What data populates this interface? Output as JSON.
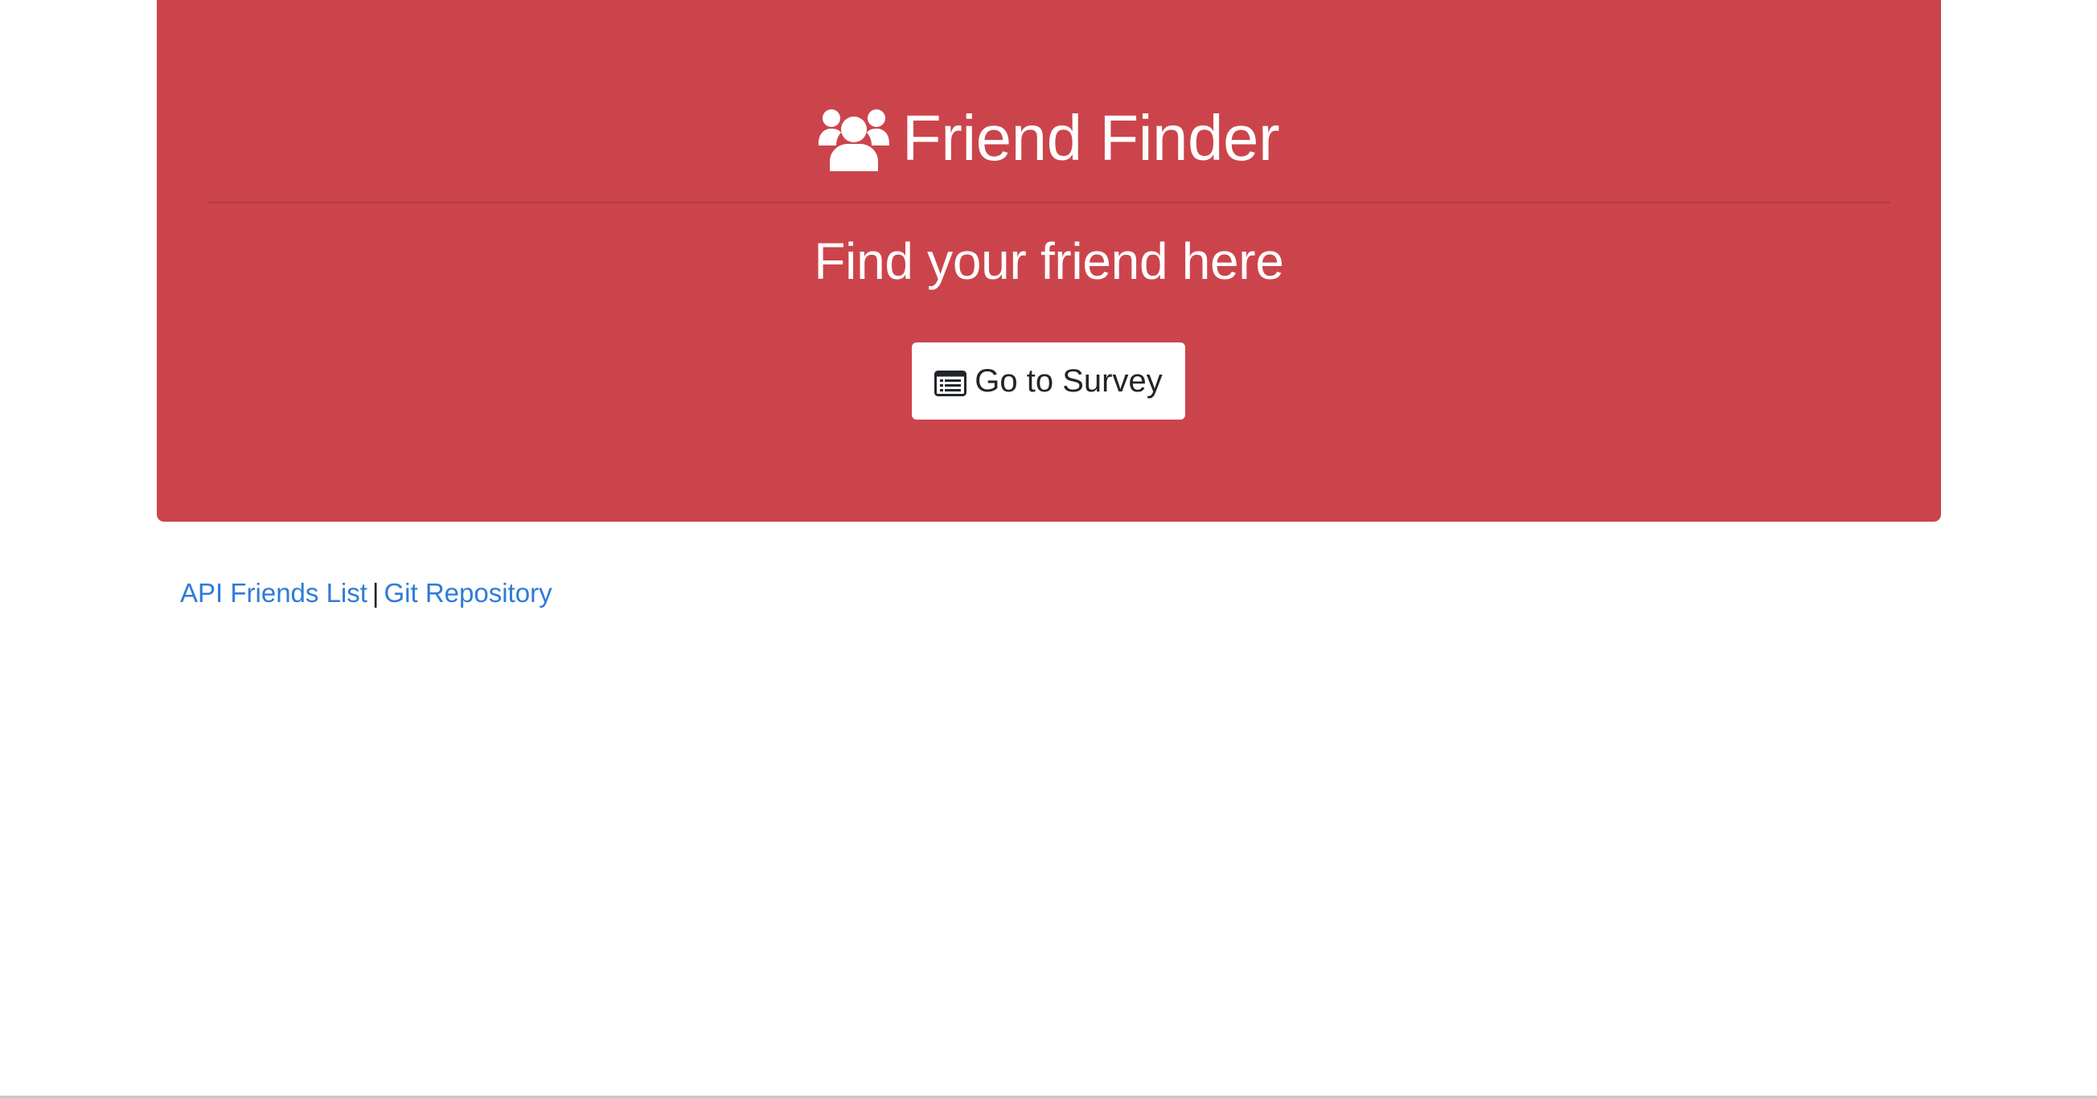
{
  "header": {
    "title": "Friend Finder",
    "title_icon": "users-icon",
    "subtitle": "Find your friend here",
    "accent_color": "#cc444b"
  },
  "survey_button": {
    "label": "Go to Survey",
    "icon": "list-alt-icon"
  },
  "footer": {
    "links": [
      {
        "label": "API Friends List"
      },
      {
        "label": "Git Repository"
      }
    ],
    "separator": "|",
    "link_color": "#2f7bd8"
  }
}
